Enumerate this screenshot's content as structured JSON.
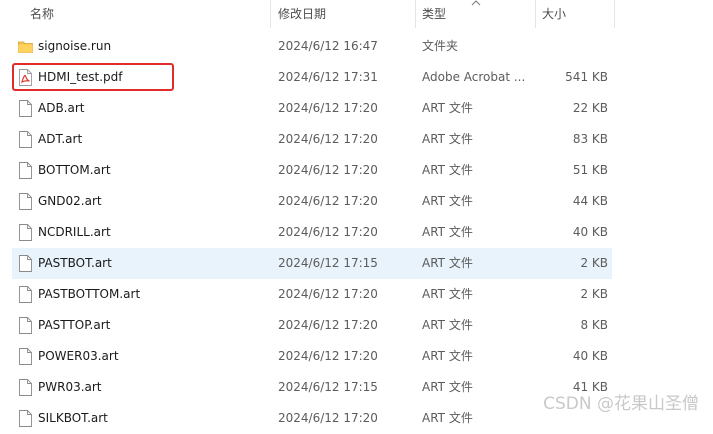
{
  "header": {
    "col_name": "名称",
    "col_date": "修改日期",
    "col_type": "类型",
    "col_size": "大小"
  },
  "files": [
    {
      "name": "signoise.run",
      "date": "2024/6/12 16:47",
      "type": "文件夹",
      "size": "",
      "icon": "folder-icon"
    },
    {
      "name": "HDMI_test.pdf",
      "date": "2024/6/12 17:31",
      "type": "Adobe Acrobat ...",
      "size": "541 KB",
      "icon": "pdf-icon"
    },
    {
      "name": "ADB.art",
      "date": "2024/6/12 17:20",
      "type": "ART 文件",
      "size": "22 KB",
      "icon": "file-icon"
    },
    {
      "name": "ADT.art",
      "date": "2024/6/12 17:20",
      "type": "ART 文件",
      "size": "83 KB",
      "icon": "file-icon"
    },
    {
      "name": "BOTTOM.art",
      "date": "2024/6/12 17:20",
      "type": "ART 文件",
      "size": "51 KB",
      "icon": "file-icon"
    },
    {
      "name": "GND02.art",
      "date": "2024/6/12 17:20",
      "type": "ART 文件",
      "size": "44 KB",
      "icon": "file-icon"
    },
    {
      "name": "NCDRILL.art",
      "date": "2024/6/12 17:20",
      "type": "ART 文件",
      "size": "40 KB",
      "icon": "file-icon"
    },
    {
      "name": "PASTBOT.art",
      "date": "2024/6/12 17:15",
      "type": "ART 文件",
      "size": "2 KB",
      "icon": "file-icon"
    },
    {
      "name": "PASTBOTTOM.art",
      "date": "2024/6/12 17:20",
      "type": "ART 文件",
      "size": "2 KB",
      "icon": "file-icon"
    },
    {
      "name": "PASTTOP.art",
      "date": "2024/6/12 17:20",
      "type": "ART 文件",
      "size": "8 KB",
      "icon": "file-icon"
    },
    {
      "name": "POWER03.art",
      "date": "2024/6/12 17:20",
      "type": "ART 文件",
      "size": "40 KB",
      "icon": "file-icon"
    },
    {
      "name": "PWR03.art",
      "date": "2024/6/12 17:15",
      "type": "ART 文件",
      "size": "41 KB",
      "icon": "file-icon"
    },
    {
      "name": "SILKBOT.art",
      "date": "2024/6/12 17:20",
      "type": "ART 文件",
      "size": "",
      "icon": "file-icon"
    }
  ],
  "selected_file": "PASTBOT.art",
  "highlighted_file": "HDMI_test.pdf",
  "watermark": "CSDN @花果山圣僧",
  "colors": {
    "highlight_border": "#e22c2c",
    "selected_row": "#e9f3fc",
    "folder": "#f4c24e",
    "pdf": "#d93a2b"
  }
}
